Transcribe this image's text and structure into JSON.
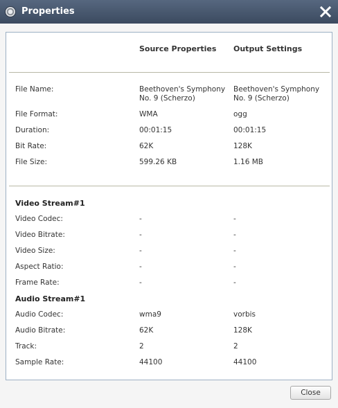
{
  "window": {
    "title": "Properties",
    "app_icon": "media-disc-icon",
    "close_icon": "close-x-icon"
  },
  "headers": {
    "source": "Source Properties",
    "output": "Output Settings"
  },
  "general": [
    {
      "label": "File Name:",
      "source": "Beethoven's Symphony\nNo. 9 (Scherzo)",
      "output": "Beethoven's Symphony\nNo. 9 (Scherzo)"
    },
    {
      "label": "File Format:",
      "source": "WMA",
      "output": "ogg"
    },
    {
      "label": "Duration:",
      "source": "00:01:15",
      "output": "00:01:15"
    },
    {
      "label": "Bit Rate:",
      "source": "62K",
      "output": "128K"
    },
    {
      "label": "File Size:",
      "source": "599.26 KB",
      "output": "1.16 MB"
    }
  ],
  "video": {
    "title": "Video Stream#1",
    "rows": [
      {
        "label": "Video Codec:",
        "source": "-",
        "output": "-"
      },
      {
        "label": "Video Bitrate:",
        "source": "-",
        "output": "-"
      },
      {
        "label": "Video Size:",
        "source": "-",
        "output": "-"
      },
      {
        "label": "Aspect Ratio:",
        "source": "-",
        "output": "-"
      },
      {
        "label": "Frame Rate:",
        "source": "-",
        "output": "-"
      }
    ]
  },
  "audio": {
    "title": "Audio Stream#1",
    "rows": [
      {
        "label": "Audio Codec:",
        "source": "wma9",
        "output": "vorbis"
      },
      {
        "label": "Audio Bitrate:",
        "source": "62K",
        "output": "128K"
      },
      {
        "label": "Track:",
        "source": "2",
        "output": "2"
      },
      {
        "label": "Sample Rate:",
        "source": "44100",
        "output": "44100"
      }
    ]
  },
  "buttons": {
    "close": "Close"
  },
  "colors": {
    "titlebar": "#4a5a72",
    "panel_border": "#9cb0c4",
    "separator": "#b8b8a6"
  }
}
